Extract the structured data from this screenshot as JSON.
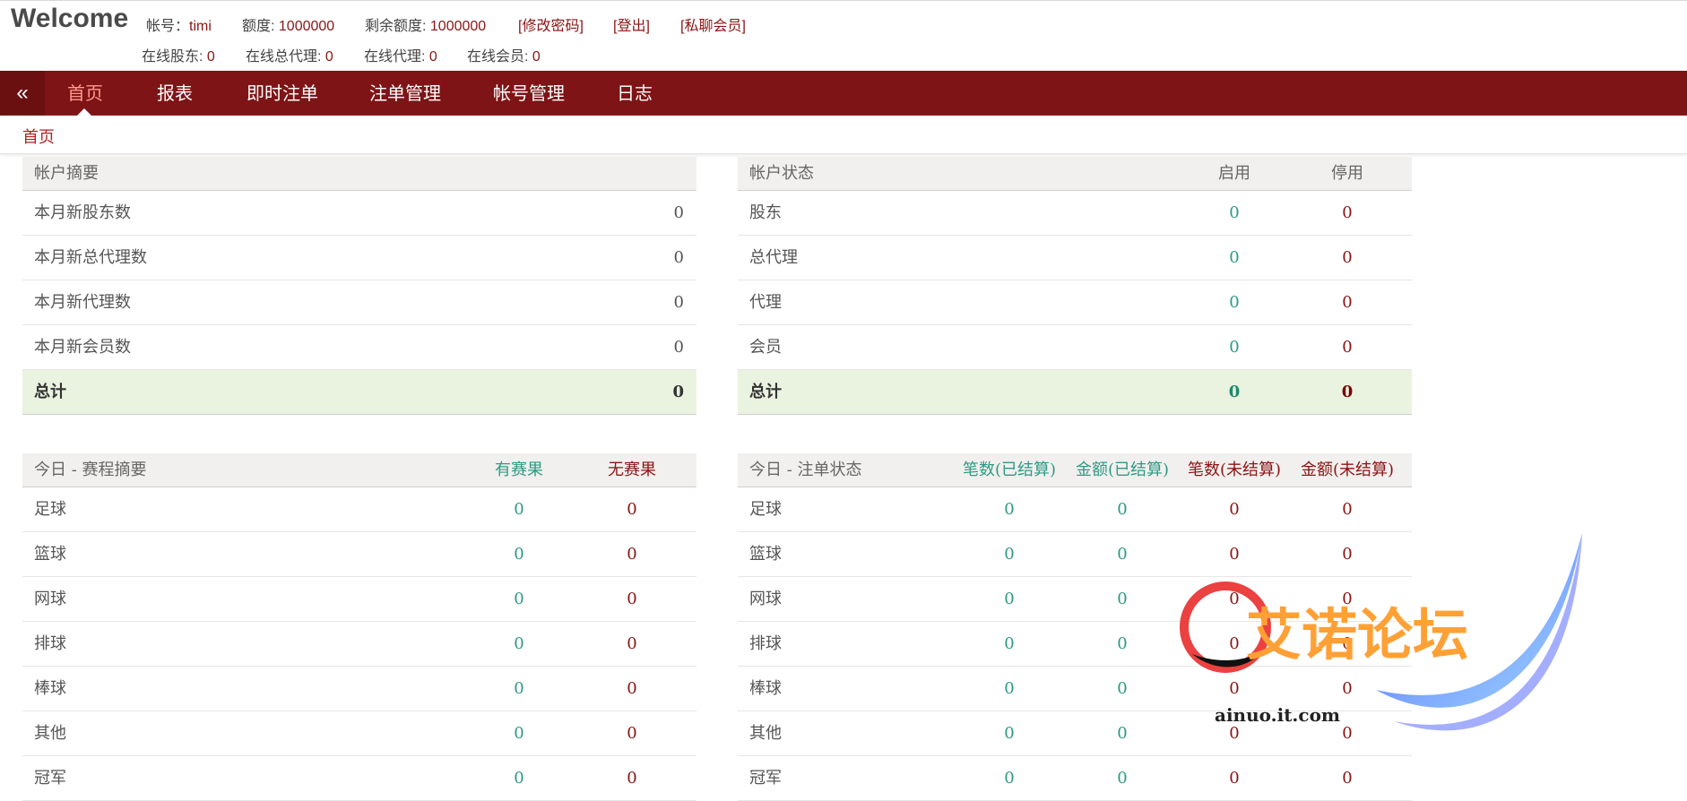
{
  "header": {
    "title": "Welcome",
    "account_label": "帐号：",
    "account_value": "timi",
    "quota_label": "额度: ",
    "quota_value": "1000000",
    "remain_label": "剩余额度: ",
    "remain_value": "1000000",
    "change_pwd": "[修改密码]",
    "logout": "[登出]",
    "private_chat": "[私聊会员]",
    "online_shareholders_label": "在线股东: ",
    "online_shareholders": "0",
    "online_general_agents_label": "在线总代理: ",
    "online_general_agents": "0",
    "online_agents_label": "在线代理: ",
    "online_agents": "0",
    "online_members_label": "在线会员: ",
    "online_members": "0"
  },
  "nav": {
    "collapse_icon": "«",
    "items": [
      {
        "label": "首页"
      },
      {
        "label": "报表"
      },
      {
        "label": "即时注单"
      },
      {
        "label": "注单管理"
      },
      {
        "label": "帐号管理"
      },
      {
        "label": "日志"
      }
    ]
  },
  "breadcrumb": "首页",
  "account_summary": {
    "title": "帐户摘要",
    "rows": [
      {
        "label": "本月新股东数",
        "value": "0"
      },
      {
        "label": "本月新总代理数",
        "value": "0"
      },
      {
        "label": "本月新代理数",
        "value": "0"
      },
      {
        "label": "本月新会员数",
        "value": "0"
      }
    ],
    "total": {
      "label": "总计",
      "value": "0"
    }
  },
  "account_status": {
    "title": "帐户状态",
    "col_enabled": "启用",
    "col_disabled": "停用",
    "rows": [
      {
        "label": "股东",
        "enabled": "0",
        "disabled": "0"
      },
      {
        "label": "总代理",
        "enabled": "0",
        "disabled": "0"
      },
      {
        "label": "代理",
        "enabled": "0",
        "disabled": "0"
      },
      {
        "label": "会员",
        "enabled": "0",
        "disabled": "0"
      }
    ],
    "total": {
      "label": "总计",
      "enabled": "0",
      "disabled": "0"
    }
  },
  "match_summary": {
    "title": "今日 - 赛程摘要",
    "col_with": "有赛果",
    "col_without": "无赛果",
    "rows": [
      {
        "label": "足球",
        "with": "0",
        "without": "0"
      },
      {
        "label": "篮球",
        "with": "0",
        "without": "0"
      },
      {
        "label": "网球",
        "with": "0",
        "without": "0"
      },
      {
        "label": "排球",
        "with": "0",
        "without": "0"
      },
      {
        "label": "棒球",
        "with": "0",
        "without": "0"
      },
      {
        "label": "其他",
        "with": "0",
        "without": "0"
      },
      {
        "label": "冠军",
        "with": "0",
        "without": "0"
      }
    ]
  },
  "bet_status": {
    "title": "今日 - 注单状态",
    "col1": "笔数(已结算)",
    "col2": "金额(已结算)",
    "col3": "笔数(未结算)",
    "col4": "金额(未结算)",
    "rows": [
      {
        "label": "足球",
        "v": [
          "0",
          "0",
          "0",
          "0"
        ]
      },
      {
        "label": "篮球",
        "v": [
          "0",
          "0",
          "0",
          "0"
        ]
      },
      {
        "label": "网球",
        "v": [
          "0",
          "0",
          "0",
          "0"
        ]
      },
      {
        "label": "排球",
        "v": [
          "0",
          "0",
          "0",
          "0"
        ]
      },
      {
        "label": "棒球",
        "v": [
          "0",
          "0",
          "0",
          "0"
        ]
      },
      {
        "label": "其他",
        "v": [
          "0",
          "0",
          "0",
          "0"
        ]
      },
      {
        "label": "冠军",
        "v": [
          "0",
          "0",
          "0",
          "0"
        ]
      }
    ]
  },
  "watermark": {
    "text": "艾诺论坛",
    "url": "ainuo.it.com"
  },
  "colors": {
    "nav_bg": "#7e1416",
    "accent_red": "#8a1515",
    "accent_green": "#2e9a86",
    "total_bg": "#eaf3df"
  }
}
